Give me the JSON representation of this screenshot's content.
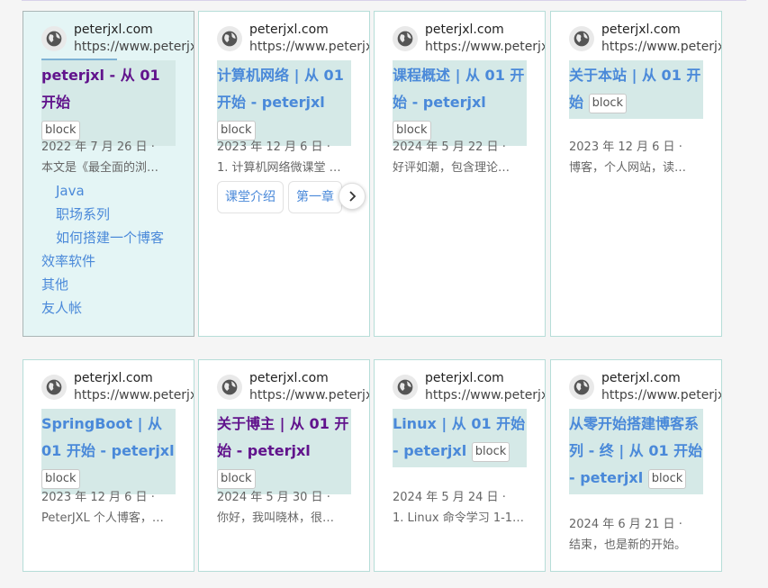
{
  "cards": [
    {
      "site": "peterjxl.com",
      "url": "https://www.peterjxl.com",
      "title": "peterjxl - 从 01 开始",
      "block": "block",
      "date": "2022 年 7 月 26 日 ·",
      "snippet": "本文是《最全面的浏…",
      "links": [
        "Java",
        "职场系列",
        "如何搭建一个博客",
        "效率软件",
        "其他",
        "友人帐"
      ]
    },
    {
      "site": "peterjxl.com",
      "url": "https://www.peterjxl.com",
      "title": "计算机网络 | 从 01 开始 - peterjxl",
      "block": "block",
      "date": "2023 年 12 月 6 日 ·",
      "snippet": "1. 计算机网络微课堂 …",
      "chips": [
        "课堂介绍",
        "第一章"
      ]
    },
    {
      "site": "peterjxl.com",
      "url": "https://www.peterjxl.com",
      "title": "课程概述 | 从 01 开始 - peterjxl",
      "block": "block",
      "date": "2024 年 5 月 22 日 ·",
      "snippet": "好评如潮，包含理论…"
    },
    {
      "site": "peterjxl.com",
      "url": "https://www.peterjxl.com",
      "title": "关于本站 | 从 01 开始",
      "block": "block",
      "date": "2023 年 12 月 6 日 ·",
      "snippet": "博客，个人网站，读…"
    },
    {
      "site": "peterjxl.com",
      "url": "https://www.peterjxl.com",
      "title": "SpringBoot | 从 01 开始 - peterjxl",
      "block": "block",
      "date": "2023 年 12 月 6 日 ·",
      "snippet": "PeterJXL 个人博客，…"
    },
    {
      "site": "peterjxl.com",
      "url": "https://www.peterjxl.com",
      "title": "关于博主 | 从 01 开始 - peterjxl",
      "block": "block",
      "date": "2024 年 5 月 30 日 ·",
      "snippet": "你好，我叫晓林，很…"
    },
    {
      "site": "peterjxl.com",
      "url": "https://www.peterjxl.com",
      "title": "Linux | 从 01 开始 - peterjxl",
      "block": "block",
      "date": "2024 年 5 月 24 日 ·",
      "snippet": "1. Linux 命令学习 1-1…"
    },
    {
      "site": "peterjxl.com",
      "url": "https://www.peterjxl.com",
      "title": "从零开始搭建博客系列 - 终 | 从 01 开始 - peterjxl",
      "block": "block",
      "date": "2024 年 6 月 21 日 ·",
      "snippet": "结束，也是新的开始。"
    }
  ],
  "icons": {
    "site": "globe-icon",
    "next": "chevron-right-icon"
  },
  "colors": {
    "link": "#4a89d9",
    "visited": "#61138c",
    "title_bg": "#d5e9e7",
    "card_border": "#b6ddd8",
    "active_bg": "#e4f5f5"
  }
}
